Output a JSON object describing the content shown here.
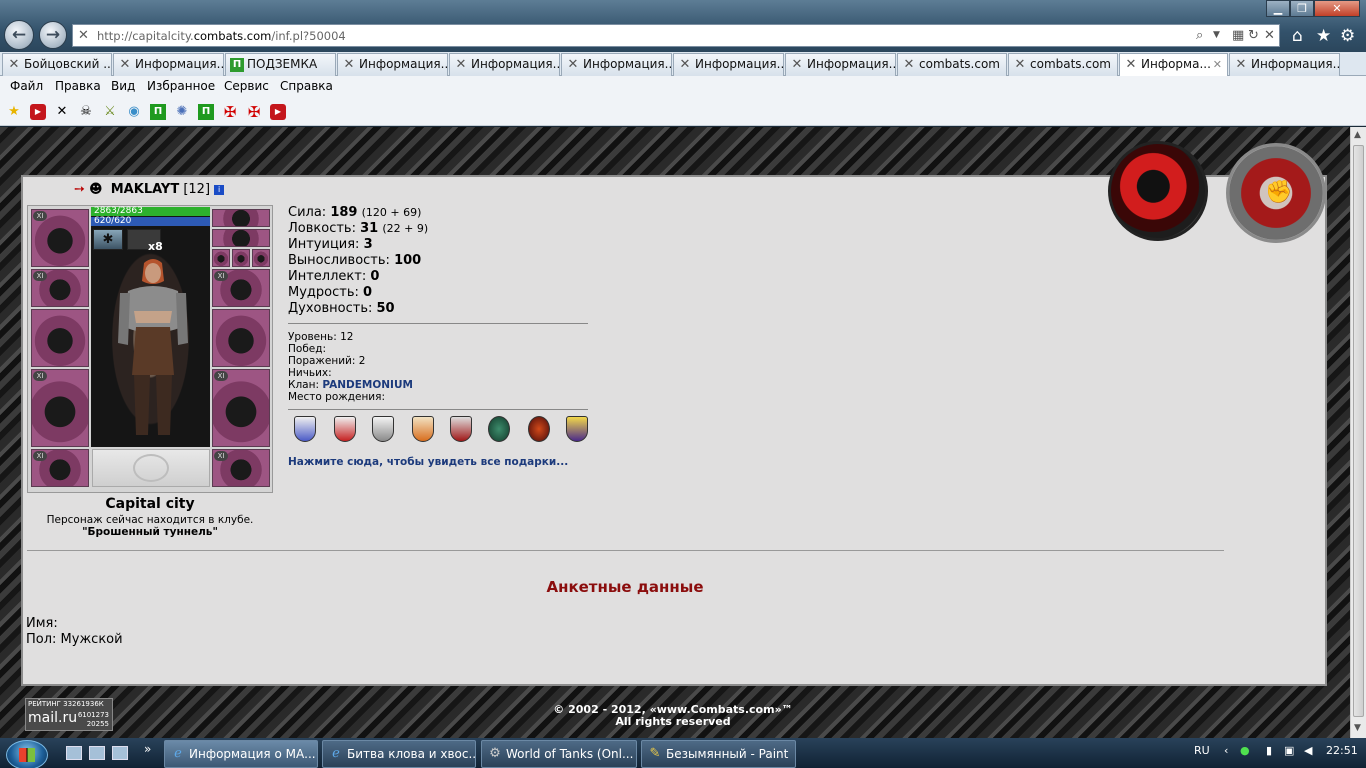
{
  "browser": {
    "url_prefix": "http://capitalcity.",
    "url_domain": "combats.com",
    "url_path": "/inf.pl?50004",
    "nav_back": "←",
    "nav_forward": "→"
  },
  "tabs": [
    {
      "label": "Бойцовский ..."
    },
    {
      "label": "Информация..."
    },
    {
      "label": "ПОДЗЕМКА"
    },
    {
      "label": "Информация..."
    },
    {
      "label": "Информация..."
    },
    {
      "label": "Информация..."
    },
    {
      "label": "Информация..."
    },
    {
      "label": "Информация..."
    },
    {
      "label": "combats.com"
    },
    {
      "label": "combats.com"
    },
    {
      "label": "Информа..."
    },
    {
      "label": "Информация..."
    }
  ],
  "menu": [
    "Файл",
    "Правка",
    "Вид",
    "Избранное",
    "Сервис",
    "Справка"
  ],
  "character": {
    "name": "MAKLAYT",
    "level": "[12]",
    "hp": "2863/2863",
    "mana": "620/620",
    "effect_count": "x8",
    "city": "Capital city",
    "location_text": "Персонаж сейчас находится в клубе.",
    "location_name": "\"Брошенный туннель\""
  },
  "stats": [
    {
      "label": "Сила:",
      "value": "189",
      "bonus": "(120 + 69)"
    },
    {
      "label": "Ловкость:",
      "value": "31",
      "bonus": "(22 + 9)"
    },
    {
      "label": "Интуиция:",
      "value": "3",
      "bonus": ""
    },
    {
      "label": "Выносливость:",
      "value": "100",
      "bonus": ""
    },
    {
      "label": "Интеллект:",
      "value": "0",
      "bonus": ""
    },
    {
      "label": "Мудрость:",
      "value": "0",
      "bonus": ""
    },
    {
      "label": "Духовность:",
      "value": "50",
      "bonus": ""
    }
  ],
  "info": {
    "level": "Уровень: 12",
    "wins": "Побед:",
    "losses": "Поражений: 2",
    "draws": "Ничьих:",
    "clan_label": "Клан:",
    "clan": "PANDEMONIUM",
    "birthplace": "Место рождения:"
  },
  "gifts_link": "Нажмите сюда, чтобы увидеть все подарки...",
  "profile": {
    "title": "Анкетные данные",
    "name": "Имя:",
    "gender": "Пол: Мужской"
  },
  "footer": {
    "rating_title": "РЕЙТИНГ 33261936К",
    "rating_brand": "mail.ru",
    "rating_n1": "6101273",
    "rating_n2": "20255",
    "copyright": "© 2002 - 2012, «www.Combats.com»™",
    "rights": "All rights reserved"
  },
  "taskbar": [
    {
      "label": "Информация о МА..."
    },
    {
      "label": "Битва клова и хвос..."
    },
    {
      "label": "World of Tanks (Onl..."
    },
    {
      "label": "Безымянный - Paint"
    }
  ],
  "tray": {
    "lang": "RU",
    "time": "22:51"
  }
}
